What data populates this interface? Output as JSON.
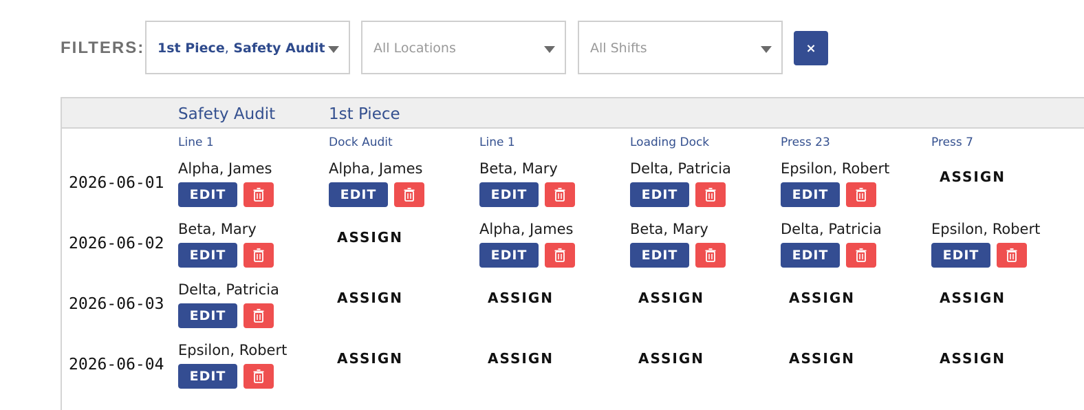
{
  "filters": {
    "label": "FILTERS:",
    "type_selected": [
      "1st Piece",
      "Safety Audit"
    ],
    "type_separator": ",",
    "locations_placeholder": "All Locations",
    "shifts_placeholder": "All Shifts",
    "clear_label": "×"
  },
  "table": {
    "groups": [
      "Safety Audit",
      "1st Piece"
    ],
    "columns": [
      "Line 1",
      "Dock Audit",
      "Line 1",
      "Loading Dock",
      "Press 23",
      "Press 7"
    ],
    "actions": {
      "edit": "EDIT",
      "assign": "ASSIGN"
    },
    "rows": [
      {
        "date": "2026-06-01",
        "cells": [
          "Alpha, James",
          "Alpha, James",
          "Beta, Mary",
          "Delta, Patricia",
          "Epsilon, Robert",
          null
        ]
      },
      {
        "date": "2026-06-02",
        "cells": [
          "Beta, Mary",
          null,
          "Alpha, James",
          "Beta, Mary",
          "Delta, Patricia",
          "Epsilon, Robert"
        ]
      },
      {
        "date": "2026-06-03",
        "cells": [
          "Delta, Patricia",
          null,
          null,
          null,
          null,
          null
        ]
      },
      {
        "date": "2026-06-04",
        "cells": [
          "Epsilon, Robert",
          null,
          null,
          null,
          null,
          null
        ]
      }
    ]
  },
  "colors": {
    "primary": "#344d92",
    "danger": "#ef4f4f",
    "header_bg": "#efefef",
    "link": "#34508f"
  },
  "icons": {
    "delete": "trash-icon",
    "dropdown": "caret-down-icon",
    "clear": "close-icon"
  }
}
